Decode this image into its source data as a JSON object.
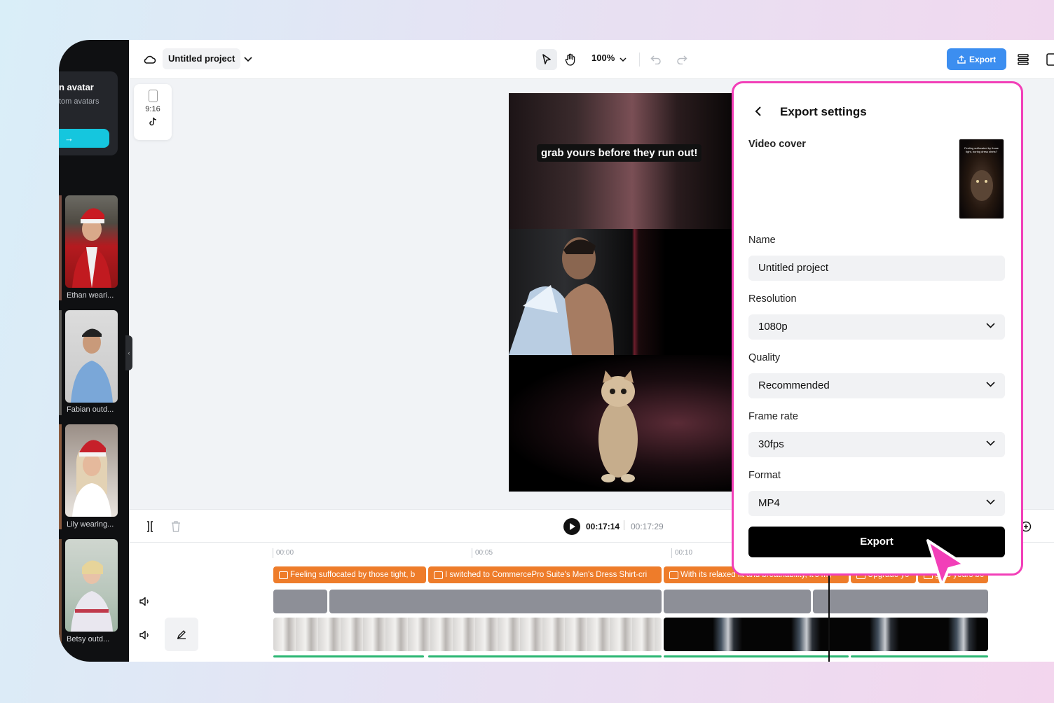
{
  "topbar": {
    "project_name": "Untitled project",
    "zoom": "100%",
    "export_label": "Export"
  },
  "sidebar": {
    "avatar_card": {
      "title": "n avatar",
      "subtitle": "tom avatars",
      "cta_glyph": "→"
    },
    "avatars": [
      {
        "label": "Ethan weari..."
      },
      {
        "label": "Fabian outd..."
      },
      {
        "label": "Lily wearing..."
      },
      {
        "label": "Betsy outd..."
      }
    ]
  },
  "format_chip": {
    "ratio": "9:16",
    "platform_icon": "tiktok-icon"
  },
  "preview": {
    "caption": "grab yours before they run out!"
  },
  "timeline": {
    "current_time": "00:17:14",
    "total_time": "00:17:29",
    "ruler": [
      "00:00",
      "00:05",
      "00:10"
    ],
    "caption_clips": [
      "Feeling suffocated by those tight, b",
      "I switched to CommercePro Suite's Men's Dress Shirt-cri",
      "With its relaxed fit and breathability, it's my",
      "Upgrade yo",
      "grab yours be"
    ]
  },
  "export_panel": {
    "title": "Export settings",
    "video_cover_label": "Video cover",
    "cover_text": "Feeling suffocated by those tight, boring dress shirts?",
    "name_label": "Name",
    "name_value": "Untitled project",
    "resolution_label": "Resolution",
    "resolution_value": "1080p",
    "quality_label": "Quality",
    "quality_value": "Recommended",
    "frame_rate_label": "Frame rate",
    "frame_rate_value": "30fps",
    "format_label": "Format",
    "format_value": "MP4",
    "export_button": "Export"
  },
  "colors": {
    "accent_blue": "#3c8ef0",
    "highlight_pink": "#f23fb8",
    "caption_orange": "#ee7c2a",
    "cta_cyan": "#15c6de"
  }
}
